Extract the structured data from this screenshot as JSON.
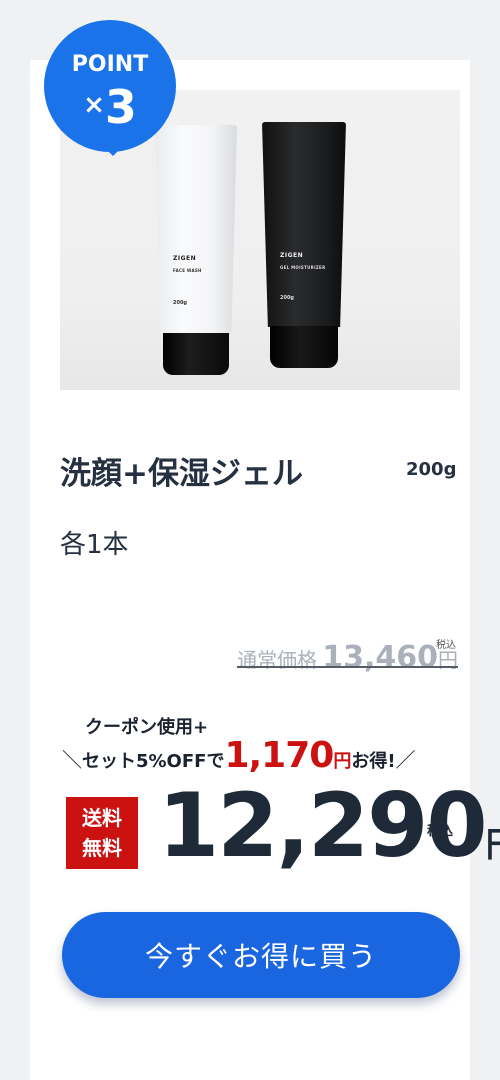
{
  "badge": {
    "label": "POINT",
    "times": "×",
    "number": "3"
  },
  "product": {
    "title": "洗顔+保湿ジェル",
    "size": "200g",
    "subtitle": "各1本"
  },
  "tubes": {
    "white": {
      "brand": "ZIGEN",
      "name": "FACE WASH",
      "volume": "200g",
      "color": "#f6f7f9",
      "cap": "#111111"
    },
    "black": {
      "brand": "ZIGEN",
      "name": "GEL MOISTURIZER",
      "volume": "200g",
      "color": "#202123",
      "cap": "#111111"
    }
  },
  "pricing": {
    "regular_label": "通常価格",
    "regular_amount": "13,460",
    "regular_yen": "円",
    "regular_tax": "税込",
    "coupon_line1": "クーポン使用+",
    "coupon_slash_left": "＼",
    "coupon_text": "セット5%OFFで",
    "coupon_amount": "1,170",
    "coupon_yen": "円",
    "coupon_suffix": "お得!",
    "coupon_slash_right": "／",
    "free_shipping_1": "送料",
    "free_shipping_2": "無料",
    "sale_amount": "12,290",
    "sale_yen": "円",
    "sale_tax": "税込"
  },
  "cta": {
    "label": "今すぐお得に買う"
  },
  "colors": {
    "accent": "#1a73e8",
    "cta": "#1a66e0",
    "red": "#cc1111",
    "text": "#253040",
    "card": "#ffffff",
    "background": "#f0f1f3"
  }
}
